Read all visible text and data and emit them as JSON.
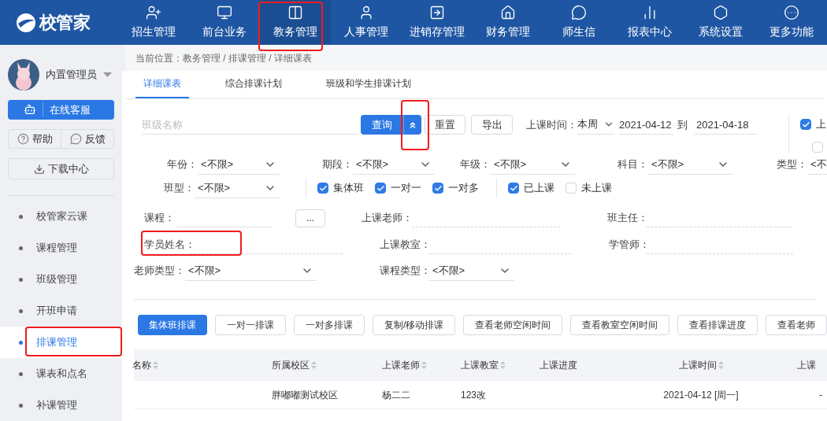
{
  "logo": "校管家",
  "nav": [
    {
      "label": "招生管理",
      "selected": false,
      "highlighted": false
    },
    {
      "label": "前台业务",
      "selected": false,
      "highlighted": false
    },
    {
      "label": "教务管理",
      "selected": true,
      "highlighted": true
    },
    {
      "label": "人事管理",
      "selected": false,
      "highlighted": false
    },
    {
      "label": "进销存管理",
      "selected": false,
      "highlighted": false
    },
    {
      "label": "财务管理",
      "selected": false,
      "highlighted": false
    },
    {
      "label": "师生信",
      "selected": false,
      "highlighted": false
    },
    {
      "label": "报表中心",
      "selected": false,
      "highlighted": false
    },
    {
      "label": "系统设置",
      "selected": false,
      "highlighted": false
    },
    {
      "label": "更多功能",
      "selected": false,
      "highlighted": false
    }
  ],
  "user": {
    "name": "内置管理员"
  },
  "service_button": "在线客服",
  "help": "帮助",
  "feedback": "反馈",
  "download": "下载中心",
  "sidebar": [
    {
      "label": "校管家云课",
      "selected": false,
      "highlighted": false
    },
    {
      "label": "课程管理",
      "selected": false,
      "highlighted": false
    },
    {
      "label": "班级管理",
      "selected": false,
      "highlighted": false
    },
    {
      "label": "开班申请",
      "selected": false,
      "highlighted": false
    },
    {
      "label": "排课管理",
      "selected": true,
      "highlighted": true
    },
    {
      "label": "课表和点名",
      "selected": false,
      "highlighted": false
    },
    {
      "label": "补课管理",
      "selected": false,
      "highlighted": false
    }
  ],
  "breadcrumb": "当前位置：教务管理 / 排课管理 / 详细课表",
  "tabs": [
    {
      "label": "详细课表",
      "selected": true
    },
    {
      "label": "综合排课计划",
      "selected": false
    },
    {
      "label": "班级和学生排课计划",
      "selected": false
    }
  ],
  "search": {
    "placeholder": "班级名称",
    "query": "查询",
    "expand_highlighted": true,
    "reset": "重置",
    "export": "导出"
  },
  "time": {
    "label": "上课时间：",
    "period": "本周",
    "from": "2021-04-12",
    "to_label": "到",
    "to": "2021-04-18"
  },
  "side_options": [
    {
      "label": "上",
      "checked": true
    },
    {
      "checked": false
    }
  ],
  "selects": [
    {
      "label": "年份：",
      "value": "<不限>"
    },
    {
      "label": "期段：",
      "value": "<不限>"
    },
    {
      "label": "年级：",
      "value": "<不限>"
    },
    {
      "label": "科目：",
      "value": "<不限>"
    },
    {
      "label": "类型：",
      "value": "<不"
    }
  ],
  "class_type": {
    "label": "班型：",
    "value": "<不限>"
  },
  "class_kinds": [
    {
      "label": "集体班",
      "checked": true
    },
    {
      "label": "一对一",
      "checked": true
    },
    {
      "label": "一对多",
      "checked": true
    }
  ],
  "lesson_states": [
    {
      "label": "已上课",
      "checked": true
    },
    {
      "label": "未上课",
      "checked": false
    }
  ],
  "course": {
    "label": "课程：",
    "picker": "..."
  },
  "text_fields": [
    {
      "label": "上课老师："
    },
    {
      "label": "班主任："
    },
    {
      "label": "学员姓名：",
      "highlighted": true
    },
    {
      "label": "上课教室："
    },
    {
      "label": "学管师："
    }
  ],
  "teacher_type": {
    "label": "老师类型：",
    "value": "<不限>"
  },
  "course_type": {
    "label": "课程类型：",
    "value": "<不限>"
  },
  "actions": [
    {
      "label": "集体班排课",
      "primary": true
    },
    {
      "label": "一对一排课",
      "primary": false
    },
    {
      "label": "一对多排课",
      "primary": false
    },
    {
      "label": "复制/移动排课",
      "primary": false
    },
    {
      "label": "查看老师空闲时间",
      "primary": false
    },
    {
      "label": "查看教室空闲时间",
      "primary": false
    },
    {
      "label": "查看排课进度",
      "primary": false
    },
    {
      "label": "查看老师",
      "primary": false
    }
  ],
  "table": {
    "columns": [
      {
        "label": "名称",
        "sortable": true
      },
      {
        "label": "所属校区",
        "sortable": true
      },
      {
        "label": "上课老师",
        "sortable": true
      },
      {
        "label": "上课教室",
        "sortable": true
      },
      {
        "label": "上课进度",
        "sortable": false
      },
      {
        "label": "上课时间",
        "sortable": true
      },
      {
        "label": "上课"
      }
    ],
    "rows": [
      [
        "",
        "胖嘟嘟测试校区",
        "杨二二",
        "123改",
        "",
        "2021-04-12 [周一]",
        "-"
      ]
    ]
  }
}
